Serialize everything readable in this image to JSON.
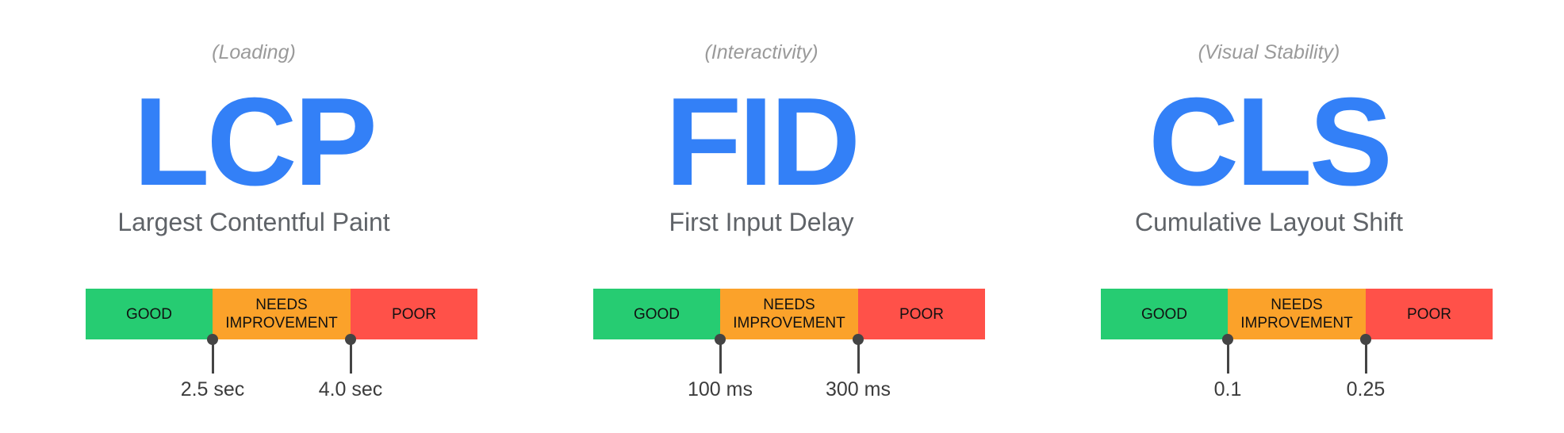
{
  "colors": {
    "accent": "#3380f7",
    "good": "#26cc72",
    "needs_improvement": "#fba22a",
    "poor": "#ff5149",
    "marker": "#444444"
  },
  "metrics": [
    {
      "category": "(Loading)",
      "abbr": "LCP",
      "name": "Largest Contentful Paint",
      "segments": {
        "good": "GOOD",
        "needs_1": "NEEDS",
        "needs_2": "IMPROVEMENT",
        "poor": "POOR"
      },
      "thresholds": [
        "2.5 sec",
        "4.0 sec"
      ]
    },
    {
      "category": "(Interactivity)",
      "abbr": "FID",
      "name": "First Input Delay",
      "segments": {
        "good": "GOOD",
        "needs_1": "NEEDS",
        "needs_2": "IMPROVEMENT",
        "poor": "POOR"
      },
      "thresholds": [
        "100 ms",
        "300 ms"
      ]
    },
    {
      "category": "(Visual Stability)",
      "abbr": "CLS",
      "name": "Cumulative Layout Shift",
      "segments": {
        "good": "GOOD",
        "needs_1": "NEEDS",
        "needs_2": "IMPROVEMENT",
        "poor": "POOR"
      },
      "thresholds": [
        "0.1",
        "0.25"
      ]
    }
  ]
}
